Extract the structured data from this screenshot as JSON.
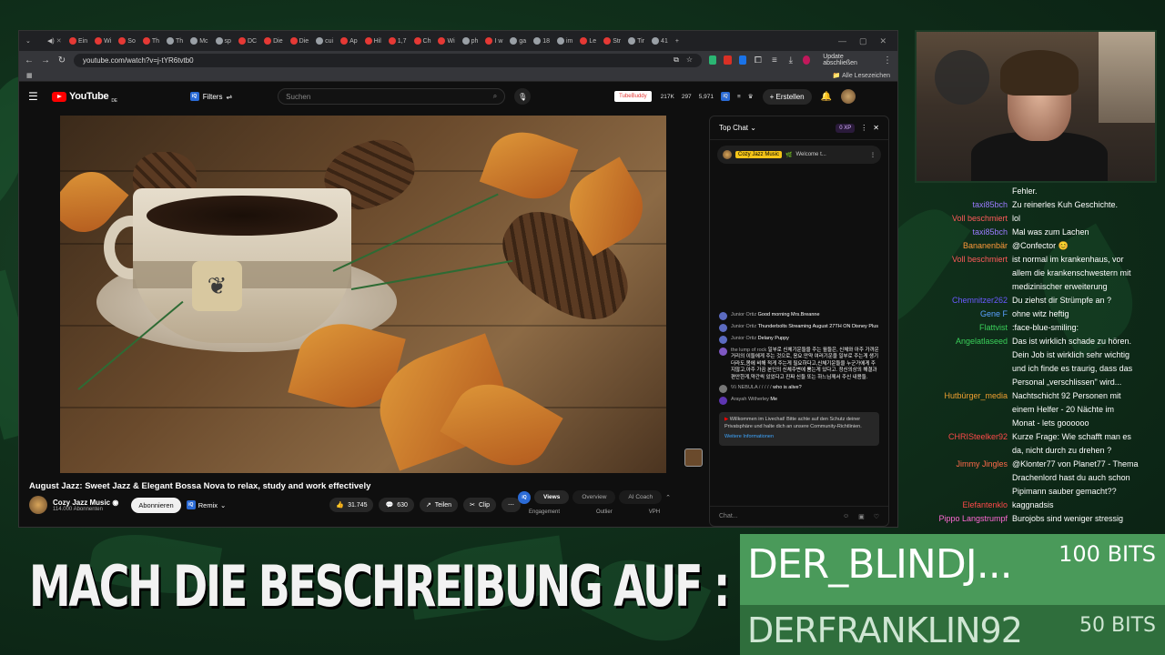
{
  "browser": {
    "tabs": [
      "Ein",
      "Wi",
      "So",
      "Th",
      "Th",
      "Mc",
      "sp",
      "DC",
      "Die",
      "Die",
      "cui",
      "Ap",
      "Hil",
      "1,7",
      "Ch",
      "Wi",
      "ph",
      "I w",
      "ga",
      "18",
      "im",
      "Le",
      "Str",
      "Tir",
      "41"
    ],
    "url": "youtube.com/watch?v=j-tYR6tvtb0",
    "update_label": "Update abschließen",
    "all_bookmarks": "Alle Lesezeichen"
  },
  "youtube": {
    "logo": "YouTube",
    "region": "DE",
    "filters_label": "Filters",
    "search_placeholder": "Suchen",
    "tubebuddy": "TubeBuddy",
    "stats": [
      "217K",
      "297",
      "5,971"
    ],
    "create_label": "Erstellen",
    "video_title": "August Jazz: Sweet Jazz & Elegant Bossa Nova to relax, study and work effectively",
    "channel_name": "Cozy Jazz Music",
    "subscribers": "114.000 Abonnenten",
    "subscribe_label": "Abonnieren",
    "remix_label": "Remix",
    "likes": "31.745",
    "comments": "630",
    "share_label": "Teilen",
    "clip_label": "Clip",
    "analytics_tabs": [
      "Views",
      "Overview",
      "AI Coach"
    ],
    "analytics_sub": [
      "Engagement",
      "Outlier",
      "VPH"
    ]
  },
  "yt_chat": {
    "header": "Top Chat",
    "xp": "0 XP",
    "pinned_channel": "Cozy Jazz Music",
    "pinned_text": "Welcome t...",
    "messages": [
      {
        "author": "Junior Ortiz",
        "text": "Good morning Mrs.Breanne"
      },
      {
        "author": "Junior Ortiz",
        "text": "Thunderbolts Streaming August 27TH ON Disney Plus"
      },
      {
        "author": "Junior Ortiz",
        "text": "Delany Puppy"
      },
      {
        "author": "the lump of rock",
        "text": "일부로 신체기운들을 주는 월들은, 신체와 아주 가까운 거리의 이들에게 주는 것으로, 응요.만약 여러기운을 일부로 주는게 생기더라도,몸에 비해 적게 주는게 필요하다고,신체기운들을 누군가에게 주지않고,아주 가끔 본인의 신체주변에 뿜는게 있다고. 정신의상의 해결과 편안한게,약간씩 있었다고 진짜 신들 또는 하느님께서 주신 내용들."
      },
      {
        "author": "\\\\\\\\ NEBULA / / / / /",
        "text": "who is alive?"
      },
      {
        "author": "Arayah Witherley",
        "text": "Me"
      }
    ],
    "notice": "Willkommen im Livechat! Bitte achte auf den Schutz deiner Privatsphäre und halte dich an unsere Community-Richtlinien.",
    "notice_link": "Weitere Informationen",
    "input_placeholder": "Chat..."
  },
  "twitch_chat": [
    {
      "name": "",
      "text": "Fehler.",
      "color": "#ffffff"
    },
    {
      "name": "taxi85bch",
      "text": "Zu reinerles Kuh Geschichte.",
      "color": "#9b7bff"
    },
    {
      "name": "Voll beschmiert",
      "text": "lol",
      "color": "#ff5a5a"
    },
    {
      "name": "taxi85bch",
      "text": "Mal was zum Lachen",
      "color": "#9b7bff"
    },
    {
      "name": "Bananenbär",
      "text": "@Confector 😊",
      "color": "#ff9a3a"
    },
    {
      "name": "Voll beschmiert",
      "text": "ist normal im krankenhaus, vor",
      "color": "#ff5a5a"
    },
    {
      "name": "",
      "text": "allem die krankenschwestern mit",
      "color": "#ffffff"
    },
    {
      "name": "",
      "text": "medizinischer erweiterung",
      "color": "#ffffff"
    },
    {
      "name": "Chemnitzer262",
      "text": "Du ziehst dir Strümpfe an ?",
      "color": "#6a5aff"
    },
    {
      "name": "Gene F",
      "text": "ohne witz heftig",
      "color": "#5aa0ff"
    },
    {
      "name": "Flattvist",
      "text": ":face-blue-smiling:",
      "color": "#3acf5a"
    },
    {
      "name": "Angelatlaseed",
      "text": "Das ist wirklich schade zu hören.",
      "color": "#3acf5a"
    },
    {
      "name": "",
      "text": "Dein Job ist wirklich sehr wichtig",
      "color": "#ffffff"
    },
    {
      "name": "",
      "text": "und ich finde es traurig, dass das",
      "color": "#ffffff"
    },
    {
      "name": "",
      "text": "Personal „verschlissen\" wird...",
      "color": "#ffffff"
    },
    {
      "name": "Hutbürger_media",
      "text": "Nachtschicht 92 Personen mit",
      "color": "#f0a030"
    },
    {
      "name": "",
      "text": "einem Helfer - 20 Nächte im",
      "color": "#ffffff"
    },
    {
      "name": "",
      "text": "Monat - lets goooooo",
      "color": "#ffffff"
    },
    {
      "name": "CHRISteelker92",
      "text": "Kurze Frage: Wie schafft man es",
      "color": "#ff4a4a"
    },
    {
      "name": "",
      "text": "da, nicht durch zu drehen ?",
      "color": "#ffffff"
    },
    {
      "name": "Jimmy Jingles",
      "text": "@Klonter77 von Planet77 - Thema",
      "color": "#ff6a4a"
    },
    {
      "name": "",
      "text": "Drachenlord hast du auch schon",
      "color": "#ffffff"
    },
    {
      "name": "",
      "text": "Pipimann sauber gemacht??",
      "color": "#ffffff"
    },
    {
      "name": "Elefantenklo",
      "text": "kaggnadsis",
      "color": "#ff4a4a"
    },
    {
      "name": "Pippo Langstrumpf",
      "text": "Burojobs sind weniger stressig",
      "color": "#ff6ad5"
    }
  ],
  "overlay": {
    "banner": "MACH DIE BESCHREIBUNG AUF : )",
    "bits": [
      {
        "name": "DER_BLINDJ...",
        "amount": "100 BITS"
      },
      {
        "name": "DERFRANKLIN92",
        "amount": "50 BITS"
      }
    ]
  }
}
